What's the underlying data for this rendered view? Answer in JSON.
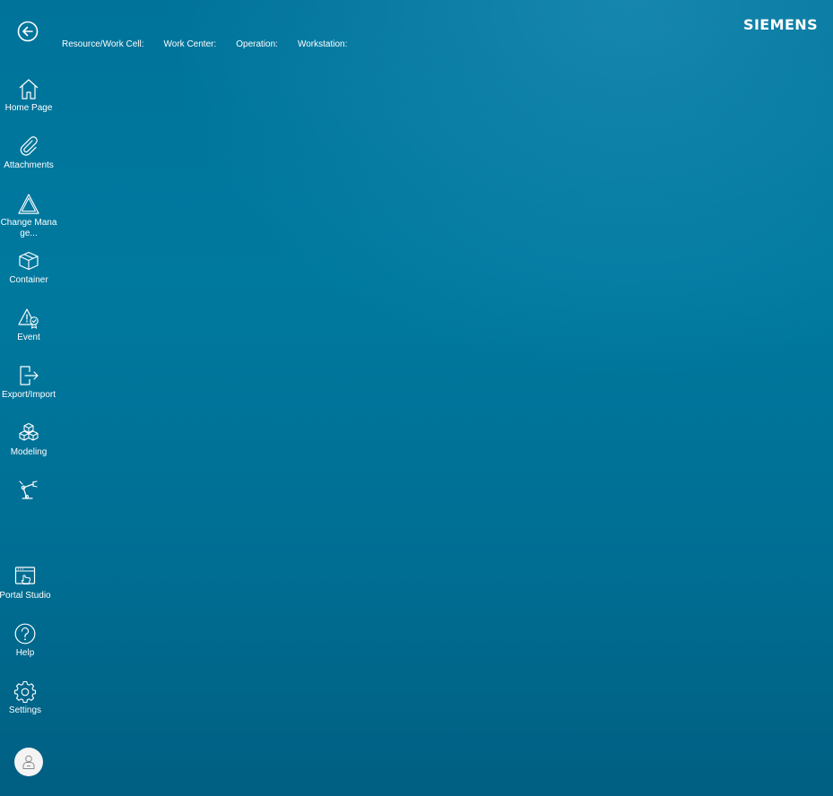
{
  "header": {
    "back_icon": "arrow-left-circle-icon",
    "context": {
      "resource": "Resource/Work Cell:",
      "work_center": "Work Center:",
      "operation": "Operation:",
      "workstation": "Workstation:"
    },
    "brand": "SIEMENS"
  },
  "sidebar": {
    "items": [
      {
        "label": "Home Page",
        "icon": "home-icon"
      },
      {
        "label": "Attachments",
        "icon": "paperclip-icon"
      },
      {
        "label": "Change Manage...",
        "icon": "triangle-icon"
      },
      {
        "label": "Container",
        "icon": "box-icon"
      },
      {
        "label": "Event",
        "icon": "event-alert-icon"
      },
      {
        "label": "Export/Import",
        "icon": "export-icon"
      },
      {
        "label": "Modeling",
        "icon": "cubes-icon"
      },
      {
        "label": "",
        "icon": "robot-arm-icon"
      }
    ],
    "bottom_items": [
      {
        "label": "Portal Studio",
        "icon": "portal-studio-icon"
      },
      {
        "label": "Help",
        "icon": "help-icon"
      },
      {
        "label": "Settings",
        "icon": "gear-icon"
      }
    ],
    "user": {
      "icon": "user-avatar-icon"
    }
  },
  "colors": {
    "background_top": "#00799f",
    "background_bottom": "#005f82",
    "text": "#ffffff"
  }
}
